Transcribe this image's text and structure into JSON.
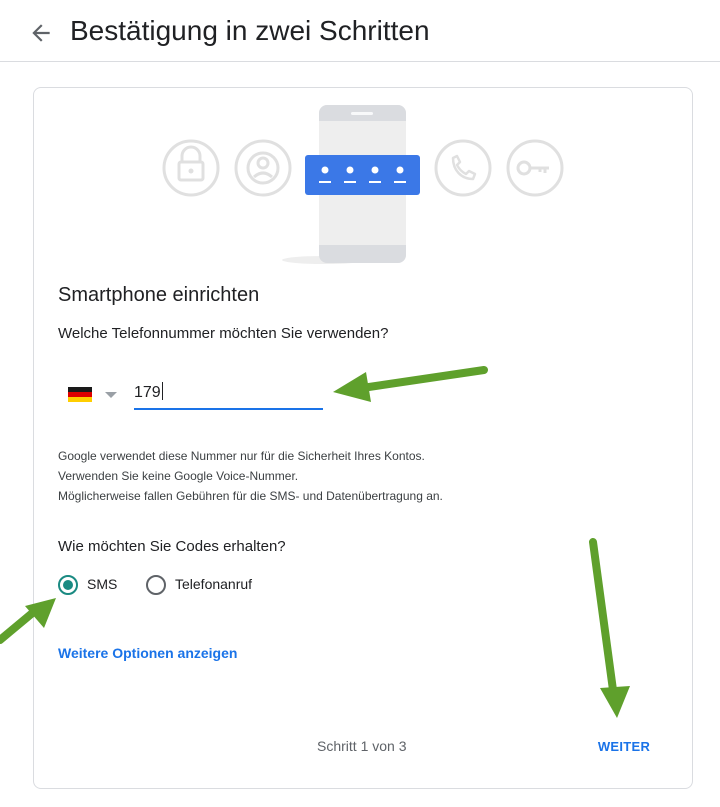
{
  "header": {
    "back_icon": "arrow-back-icon",
    "title": "Bestätigung in zwei Schritten"
  },
  "illustration": {
    "icons": [
      "lock-icon",
      "account-icon",
      "phone-call-icon",
      "key-icon"
    ],
    "accent_color": "#3b78e7"
  },
  "card": {
    "title": "Smartphone einrichten",
    "phone_question": "Welche Telefonnummer möchten Sie verwenden?",
    "country": {
      "selected": "DE",
      "flag_icon": "germany-flag-icon"
    },
    "phone_value": "179",
    "hint_lines": [
      "Google verwendet diese Nummer nur für die Sicherheit Ihres Kontos.",
      "Verwenden Sie keine Google Voice-Nummer.",
      "Möglicherweise fallen Gebühren für die SMS- und Datenübertragung an."
    ],
    "codes_question": "Wie möchten Sie Codes erhalten?",
    "options": [
      {
        "label": "SMS",
        "checked": true
      },
      {
        "label": "Telefonanruf",
        "checked": false
      }
    ],
    "more_options": "Weitere Optionen anzeigen",
    "step": "Schritt 1 von 3",
    "next": "WEITER"
  },
  "colors": {
    "link": "#1a73e8",
    "radio_checked": "#1a8a82",
    "annotation_arrow": "#5fa02c"
  }
}
